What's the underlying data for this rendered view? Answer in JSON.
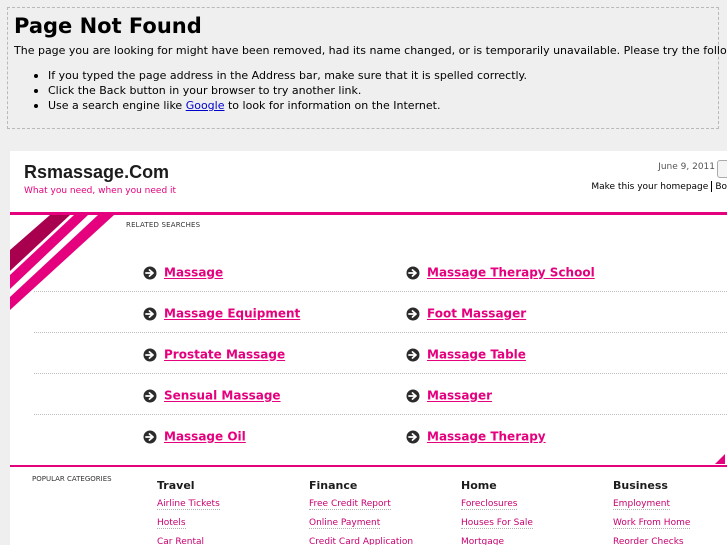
{
  "error": {
    "title": "Page Not Found",
    "description": "The page you are looking for might have been removed, had its name changed, or is temporarily unavailable. Please try the following:",
    "tips": [
      "If you typed the page address in the Address bar, make sure that it is spelled correctly.",
      "Click the Back button in your browser to try another link."
    ],
    "tip3_before": "Use a search engine like ",
    "tip3_link": "Google",
    "tip3_after": " to look for information on the Internet."
  },
  "site": {
    "name": "Rsmassage.Com",
    "tagline": "What you need, when you need it",
    "date": "June 9, 2011",
    "homepage": "Make this your homepage",
    "bookmark_partial": "Bo"
  },
  "related": {
    "label": "RELATED SEARCHES",
    "rows": [
      [
        "Massage",
        "Massage Therapy School"
      ],
      [
        "Massage Equipment",
        "Foot Massager"
      ],
      [
        "Prostate Massage",
        "Massage Table"
      ],
      [
        "Sensual Massage",
        "Massager"
      ],
      [
        "Massage Oil",
        "Massage Therapy"
      ]
    ]
  },
  "popular": {
    "label": "POPULAR CATEGORIES",
    "categories": [
      {
        "title": "Travel",
        "items": [
          "Airline Tickets",
          "Hotels",
          "Car Rental"
        ]
      },
      {
        "title": "Finance",
        "items": [
          "Free Credit Report",
          "Online Payment",
          "Credit Card Application"
        ]
      },
      {
        "title": "Home",
        "items": [
          "Foreclosures",
          "Houses For Sale",
          "Mortgage"
        ]
      },
      {
        "title": "Business",
        "items": [
          "Employment",
          "Work From Home",
          "Reorder Checks"
        ]
      }
    ]
  },
  "colors": {
    "accent": "#e5007d",
    "stripe_dark": "#a8004e"
  }
}
